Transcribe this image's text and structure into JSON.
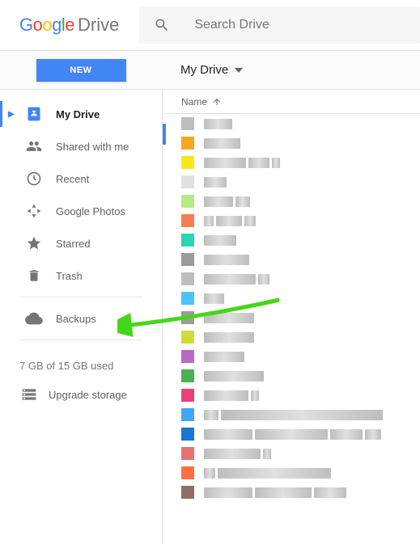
{
  "logo": {
    "product": "Drive"
  },
  "search": {
    "placeholder": "Search Drive"
  },
  "new_button": "NEW",
  "breadcrumb": "My Drive",
  "sidebar": {
    "items": [
      {
        "label": "My Drive",
        "icon": "drive"
      },
      {
        "label": "Shared with me",
        "icon": "people"
      },
      {
        "label": "Recent",
        "icon": "clock"
      },
      {
        "label": "Google Photos",
        "icon": "photos"
      },
      {
        "label": "Starred",
        "icon": "star"
      },
      {
        "label": "Trash",
        "icon": "trash"
      }
    ],
    "backups": "Backups",
    "storage": "7 GB of 15 GB used",
    "upgrade": "Upgrade storage"
  },
  "column_header": "Name",
  "files": [
    {
      "color": "#bdbdbd",
      "segs": [
        35
      ]
    },
    {
      "color": "#f5a623",
      "segs": [
        45
      ]
    },
    {
      "color": "#f8e71c",
      "segs": [
        52,
        26,
        10
      ]
    },
    {
      "color": "#e0e0e0",
      "segs": [
        28
      ]
    },
    {
      "color": "#b8e986",
      "segs": [
        36,
        18
      ]
    },
    {
      "color": "#f77e52",
      "segs": [
        12,
        32,
        14
      ]
    },
    {
      "color": "#29d6b0",
      "segs": [
        40
      ]
    },
    {
      "color": "#9b9b9b",
      "segs": [
        56
      ]
    },
    {
      "color": "#bdbdbd",
      "segs": [
        64,
        14
      ]
    },
    {
      "color": "#4fc3f7",
      "segs": [
        25
      ]
    },
    {
      "color": "#9b9b9b",
      "segs": [
        62
      ]
    },
    {
      "color": "#cddc39",
      "segs": [
        62
      ]
    },
    {
      "color": "#ba68c8",
      "segs": [
        50
      ]
    },
    {
      "color": "#4caf50",
      "segs": [
        74
      ]
    },
    {
      "color": "#ec407a",
      "segs": [
        55,
        10
      ]
    },
    {
      "color": "#42a5f5",
      "segs": [
        18,
        200
      ]
    },
    {
      "color": "#1976d2",
      "segs": [
        60,
        90,
        40,
        20
      ]
    },
    {
      "color": "#e57373",
      "segs": [
        70,
        10
      ]
    },
    {
      "color": "#ff7043",
      "segs": [
        14,
        140
      ]
    },
    {
      "color": "#8d6e63",
      "segs": [
        60,
        70,
        40
      ]
    }
  ]
}
